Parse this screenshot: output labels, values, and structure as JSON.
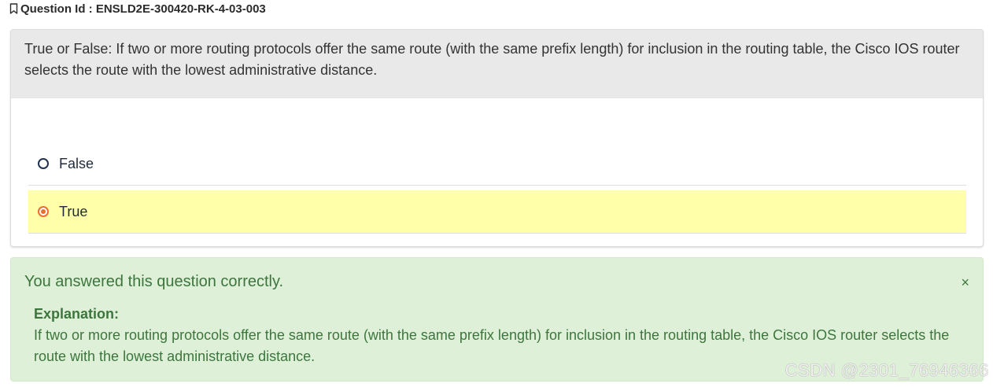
{
  "question": {
    "id_label": "Question Id : ENSLD2E-300420-RK-4-03-003",
    "text": "True or False: If two or more routing protocols offer the same route (with the same prefix length) for inclusion in the routing table, the Cisco IOS router selects the route with the lowest administrative distance."
  },
  "options": [
    {
      "label": "False",
      "selected": false
    },
    {
      "label": "True",
      "selected": true
    }
  ],
  "feedback": {
    "title": "You answered this question correctly.",
    "close_symbol": "×",
    "explanation_label": "Explanation:",
    "explanation_text": "If two or more routing protocols offer the same route (with the same prefix length) for inclusion in the routing table, the Cisco IOS router selects the route with the lowest administrative distance."
  },
  "watermark": "CSDN @2301_76946366",
  "colors": {
    "selected_highlight": "#ffffaa",
    "radio_selected": "#f06d2d",
    "success_bg": "#dff0d8",
    "success_text": "#3c763d",
    "header_bg": "#e9e9e9"
  }
}
